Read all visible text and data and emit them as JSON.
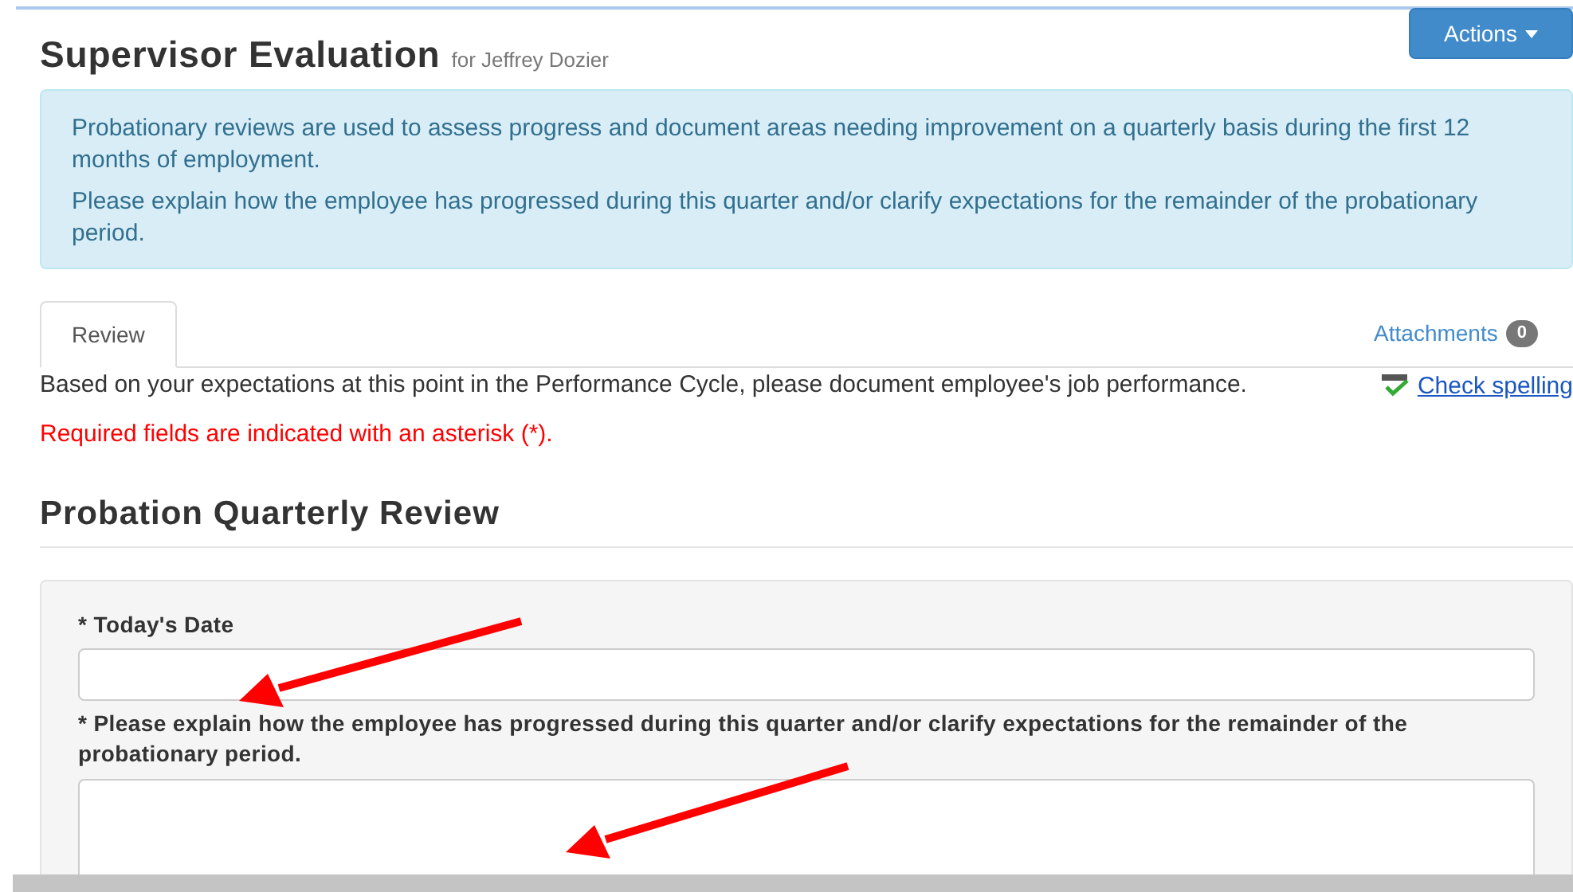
{
  "header": {
    "title": "Supervisor Evaluation",
    "subtitle": "for Jeffrey Dozier",
    "actions_button": "Actions"
  },
  "info_box": {
    "paragraphs": [
      "Probationary reviews are used to assess progress and document areas needing improvement on a quarterly basis during the first 12 months of employment.",
      "Please explain how the employee has progressed during this quarter and/or clarify expectations for the remainder of the probationary period."
    ]
  },
  "tabs": [
    {
      "label": "Review",
      "selected": true
    },
    {
      "label": "Attachments",
      "selected": false,
      "badge": "0"
    }
  ],
  "instructions": "Based on your expectations at this point in the Performance Cycle, please document employee's job performance.",
  "check_spelling": "Check spelling",
  "required_note": "Required fields are indicated with an asterisk (*).",
  "section": {
    "title": "Probation Quarterly Review",
    "fields": [
      {
        "label": "* Today's Date",
        "kind": "input"
      },
      {
        "label": "* Please explain how the employee has progressed during this quarter and/or clarify expectations for the remainder of the probationary period.",
        "kind": "textarea"
      }
    ]
  }
}
